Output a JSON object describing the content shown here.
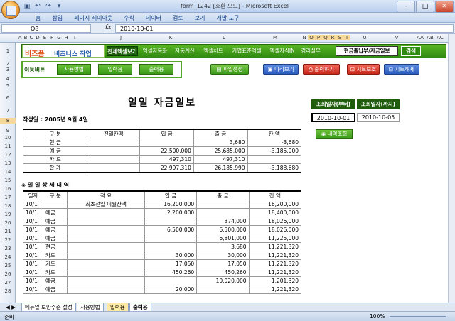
{
  "window": {
    "title": "form_1242  [호환 모드]  -  Microsoft Excel"
  },
  "ribbon_tabs": [
    "홈",
    "삽입",
    "페이지 레이아웃",
    "수식",
    "데이터",
    "검토",
    "보기",
    "개발 도구"
  ],
  "formula_bar": {
    "name_box": "O8",
    "fx": "fx",
    "value": "2010-10-01"
  },
  "columns": [
    "A",
    "B",
    "C",
    "D",
    "E",
    "F",
    "G",
    "H",
    "I",
    "J",
    "K",
    "L",
    "M",
    "N",
    "O",
    "P",
    "Q",
    "R",
    "S",
    "T",
    "U",
    "V",
    "AA",
    "AB",
    "AC"
  ],
  "rows": [
    "1",
    "2",
    "3",
    "4",
    "5",
    "6",
    "7",
    "8",
    "9",
    "10",
    "11",
    "12",
    "13",
    "14",
    "15",
    "16",
    "17",
    "18",
    "19",
    "20",
    "21",
    "22",
    "23",
    "24",
    "25",
    "26",
    "27",
    "28"
  ],
  "header": {
    "logo_a": "비즈폼",
    "logo_b": "비즈니스 작업",
    "tabs": [
      "전체엑셀보기",
      "엑셀자동화",
      "자동계산",
      "엑셀차트",
      "기업표준엑셀",
      "엑셀지식IN",
      "경리실무"
    ],
    "search_value": "현금출납부/자금일보",
    "search_button": "검색"
  },
  "move": {
    "label": "이동버튼",
    "buttons": [
      "사용방법",
      "입력용",
      "출력용"
    ]
  },
  "actions": {
    "sheet_create": "파일생성",
    "preview": "미리보기",
    "print": "출력하기",
    "protect": "시트보호",
    "unprotect": "시트해제"
  },
  "doc": {
    "title": "일일 자금일보",
    "author": "작성일 : 2005년 9월 4일"
  },
  "query": {
    "from_label": "조회일자(부터)",
    "to_label": "조회일자(까지)",
    "from_value": "2010-10-01",
    "to_value": "2010-10-05",
    "view_button": "내역조회"
  },
  "summary": {
    "headers": [
      "구      분",
      "전일잔액",
      "입      금",
      "출      금",
      "잔      액"
    ],
    "rows": [
      [
        "현            금",
        "",
        "",
        "3,680",
        "-3,680"
      ],
      [
        "예            금",
        "",
        "22,500,000",
        "25,685,000",
        "-3,185,000"
      ],
      [
        "카            드",
        "",
        "497,310",
        "497,310",
        ""
      ],
      [
        "합      계",
        "",
        "22,997,310",
        "26,185,990",
        "-3,188,680"
      ]
    ]
  },
  "detail": {
    "section_title": "◈ 일 일 상 세 내 역",
    "headers": [
      "일자",
      "구 분",
      "적            요",
      "입      금",
      "출      금",
      "잔      액"
    ],
    "rows": [
      [
        "10/1",
        "",
        "최초전일 이월잔액",
        "16,200,000",
        "",
        "16,200,000"
      ],
      [
        "10/1",
        "예금",
        "",
        "2,200,000",
        "",
        "18,400,000"
      ],
      [
        "10/1",
        "예금",
        "",
        "",
        "374,000",
        "18,026,000"
      ],
      [
        "10/1",
        "예금",
        "",
        "6,500,000",
        "6,500,000",
        "18,026,000"
      ],
      [
        "10/1",
        "예금",
        "",
        "",
        "6,801,000",
        "11,225,000"
      ],
      [
        "10/1",
        "현금",
        "",
        "",
        "3,680",
        "11,221,320"
      ],
      [
        "10/1",
        "카드",
        "",
        "30,000",
        "30,000",
        "11,221,320"
      ],
      [
        "10/1",
        "카드",
        "",
        "17,050",
        "17,050",
        "11,221,320"
      ],
      [
        "10/1",
        "카드",
        "",
        "450,260",
        "450,260",
        "11,221,320"
      ],
      [
        "10/1",
        "예금",
        "",
        "",
        "10,020,000",
        "1,201,320"
      ],
      [
        "10/1",
        "예금",
        "",
        "20,000",
        "",
        "1,221,320"
      ]
    ]
  },
  "sheet_tabs": [
    "메뉴얼 보안수준 설정",
    "사용방법",
    "입력용",
    "출력용"
  ],
  "status": {
    "left": "준비",
    "zoom": "100%"
  }
}
